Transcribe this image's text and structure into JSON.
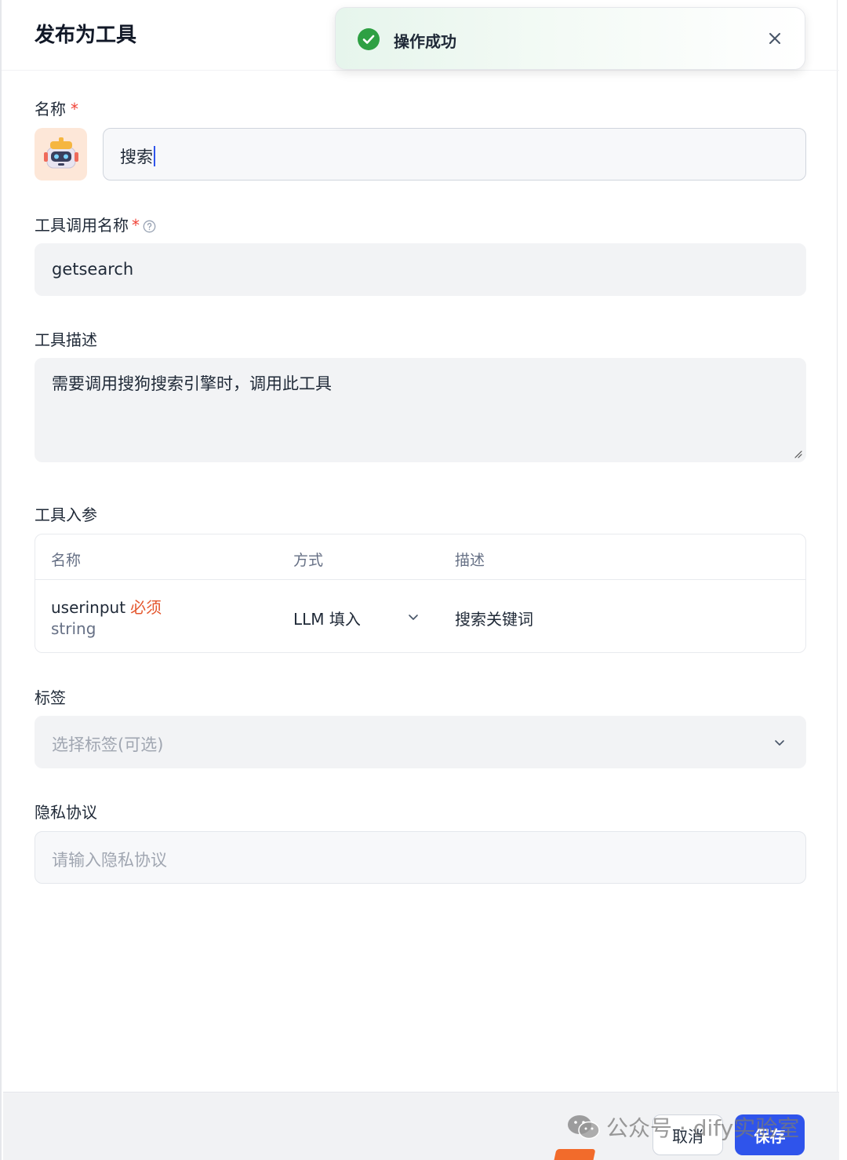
{
  "dialog": {
    "title": "发布为工具"
  },
  "toast": {
    "message": "操作成功",
    "status_color": "#2ea043"
  },
  "form": {
    "name": {
      "label": "名称",
      "required_mark": "*",
      "value": "搜索"
    },
    "call_name": {
      "label": "工具调用名称",
      "required_mark": "*",
      "value": "getsearch"
    },
    "description": {
      "label": "工具描述",
      "value": "需要调用搜狗搜索引擎时，调用此工具"
    },
    "params": {
      "label": "工具入参",
      "headers": [
        "名称",
        "方式",
        "描述"
      ],
      "rows": [
        {
          "name": "userinput",
          "required": "必须",
          "type": "string",
          "method": "LLM 填入",
          "desc": "搜索关键词"
        }
      ]
    },
    "tags": {
      "label": "标签",
      "placeholder": "选择标签(可选)"
    },
    "privacy": {
      "label": "隐私协议",
      "placeholder": "请输入隐私协议"
    }
  },
  "footer": {
    "cancel_label": "取消",
    "save_label": "保存",
    "save_color": "#2f54eb"
  },
  "watermark": {
    "text": "公众号 · dify实验室"
  }
}
